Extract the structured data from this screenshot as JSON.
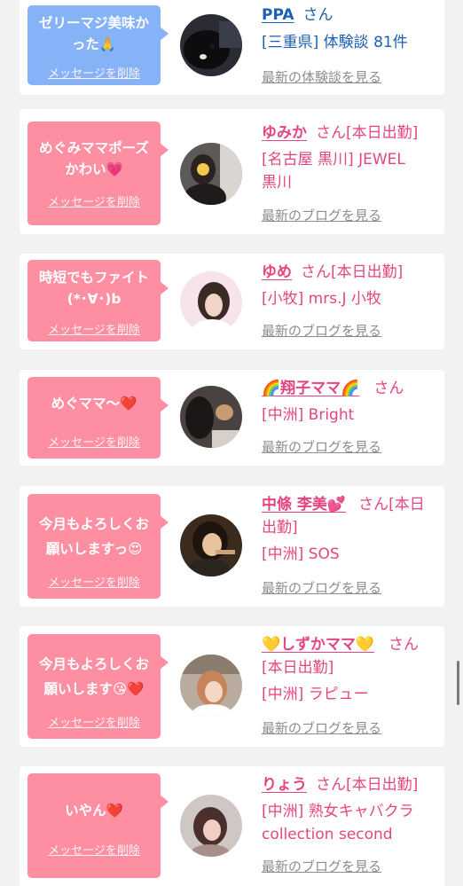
{
  "delete_label": "メッセージを削除",
  "latest_blog_label": "最新のブログを見る",
  "latest_review_label": "最新の体験談を見る",
  "san": "さん",
  "colors": {
    "pink_bubble": "#fe8fa2",
    "blue_bubble": "#86b3f8",
    "pink_text": "#e5457f",
    "blue_text": "#1c5fb5",
    "link_gray": "#8c8c8c",
    "background": "#f2f2f2"
  },
  "messages": [
    {
      "bubble_line1": "ゼリーマジ美味か",
      "bubble_line2": "った🙏",
      "name": "PPA",
      "status": "",
      "line1": "[三重県] 体験談 81件",
      "line2": "",
      "link": "最新の体験談を見る",
      "avatar_icon": "black-dog-avatar-icon"
    },
    {
      "bubble_line1": "めぐみママポーズ",
      "bubble_line2": "かわい💗",
      "name": "ゆみか",
      "status": "[本日出勤]",
      "line1": "[名古屋 黒川] JEWEL",
      "line2": "黒川",
      "link": "最新のブログを見る",
      "avatar_icon": "woman-photo-avatar-icon"
    },
    {
      "bubble_line1": "時短でもファイト",
      "bubble_line2": "(*･∀･)b",
      "name": "ゆめ",
      "status": "[本日出勤]",
      "line1": "[小牧] mrs.J 小牧",
      "line2": "",
      "link": "最新のブログを見る",
      "avatar_icon": "woman-photo-avatar-icon"
    },
    {
      "bubble_line1": "めぐママ〜❤️",
      "bubble_line2": "",
      "name": "🌈翔子ママ🌈",
      "status": "",
      "line1": "[中洲] Bright",
      "line2": "",
      "link": "最新のブログを見る",
      "avatar_icon": "woman-photo-avatar-icon"
    },
    {
      "bubble_line1": "今月もよろしくお",
      "bubble_line2": "願いしますっ😍",
      "name": "中條 李美💕",
      "status": "[本日",
      "status_cont": "出勤]",
      "line1": "[中洲] SOS",
      "line2": "",
      "link": "最新のブログを見る",
      "avatar_icon": "woman-photo-avatar-icon"
    },
    {
      "bubble_line1": "今月もよろしくお",
      "bubble_line2": "願いします😘❤️",
      "name": "💛しずかママ💛",
      "status": "",
      "status_cont": "[本日出勤]",
      "line1": "[中洲] ラピュー",
      "line2": "",
      "link": "最新のブログを見る",
      "avatar_icon": "woman-photo-avatar-icon"
    },
    {
      "bubble_line1": "いやん❤️",
      "bubble_line2": "",
      "name": "りょう",
      "status": "[本日出勤]",
      "line1": "[中洲] 熟女キャバクラ",
      "line2": "collection second",
      "link": "最新のブログを見る",
      "avatar_icon": "woman-photo-avatar-icon"
    }
  ]
}
